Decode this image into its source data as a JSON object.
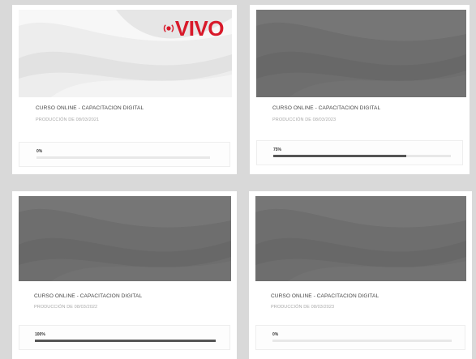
{
  "courses": [
    {
      "title": "CURSO ONLINE - CAPACITACION DIGITAL",
      "date": "PRODUCCIÓN DE 08/03/2021",
      "progress_label": "0%",
      "progress": 0,
      "thumbnail": "light",
      "badge": "VIVO"
    },
    {
      "title": "CURSO ONLINE - CAPACITACION DIGITAL",
      "date": "PRODUCCIÓN DE 08/03/2023",
      "progress_label": "75%",
      "progress": 0.75,
      "thumbnail": "dark"
    },
    {
      "title": "CURSO ONLINE - CAPACITACION DIGITAL",
      "date": "PRODUCCIÓN DE 08/03/2022",
      "progress_label": "100%",
      "progress": 1.0,
      "thumbnail": "dark"
    },
    {
      "title": "CURSO ONLINE - CAPACITACION DIGITAL",
      "date": "PRODUCCIÓN DE 08/03/2023",
      "progress_label": "0%",
      "progress": 0,
      "thumbnail": "dark"
    }
  ],
  "colors": {
    "page_background": "#d9d9d9",
    "brand_red": "#d8192a",
    "progress_fill": "#555555",
    "progress_track": "#e8e8e8"
  },
  "icons": {
    "live_badge": "broadcast-signal-icon"
  }
}
